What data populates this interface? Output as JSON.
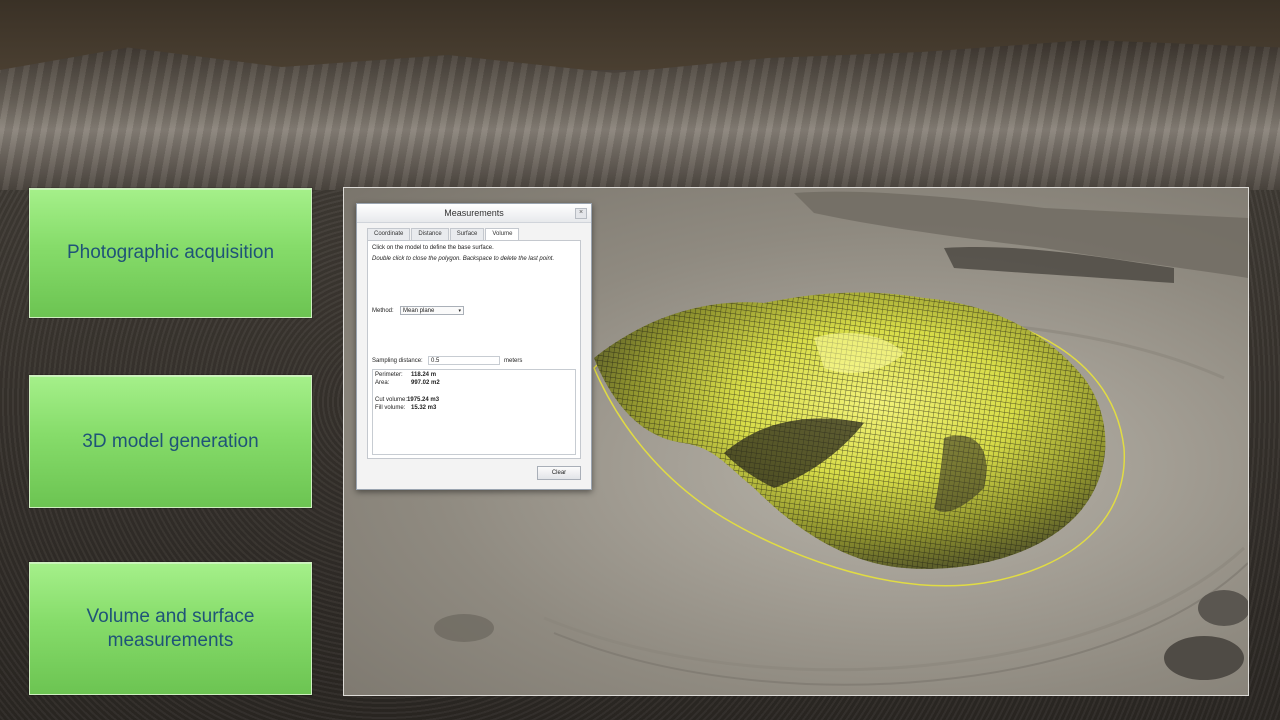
{
  "steps": [
    {
      "label": "Photographic acquisition"
    },
    {
      "label": "3D model generation"
    },
    {
      "label": "Volume and surface measurements"
    }
  ],
  "dialog": {
    "title": "Measurements",
    "close_icon": "close-icon",
    "tabs": [
      "Coordinate",
      "Distance",
      "Surface",
      "Volume"
    ],
    "active_tab": "Volume",
    "instruction_1": "Click on the model to define the base surface.",
    "instruction_2": "Double click to close the polygon. Backspace to delete the last point.",
    "method_label": "Method:",
    "method_value": "Mean plane",
    "sampling_label": "Sampling distance:",
    "sampling_value": "0.5",
    "sampling_unit": "meters",
    "results": {
      "perimeter_label": "Perimeter:",
      "perimeter_value": "118.24 m",
      "area_label": "Area:",
      "area_value": "997.02 m2",
      "cut_label": "Cut volume:",
      "cut_value": "1975.24 m3",
      "fill_label": "Fill volume:",
      "fill_value": "15.32 m3"
    },
    "clear_label": "Clear"
  },
  "colors": {
    "step_green": "#86dc6a",
    "step_text": "#1f5378",
    "mesh_yellow": "#e8f040"
  }
}
